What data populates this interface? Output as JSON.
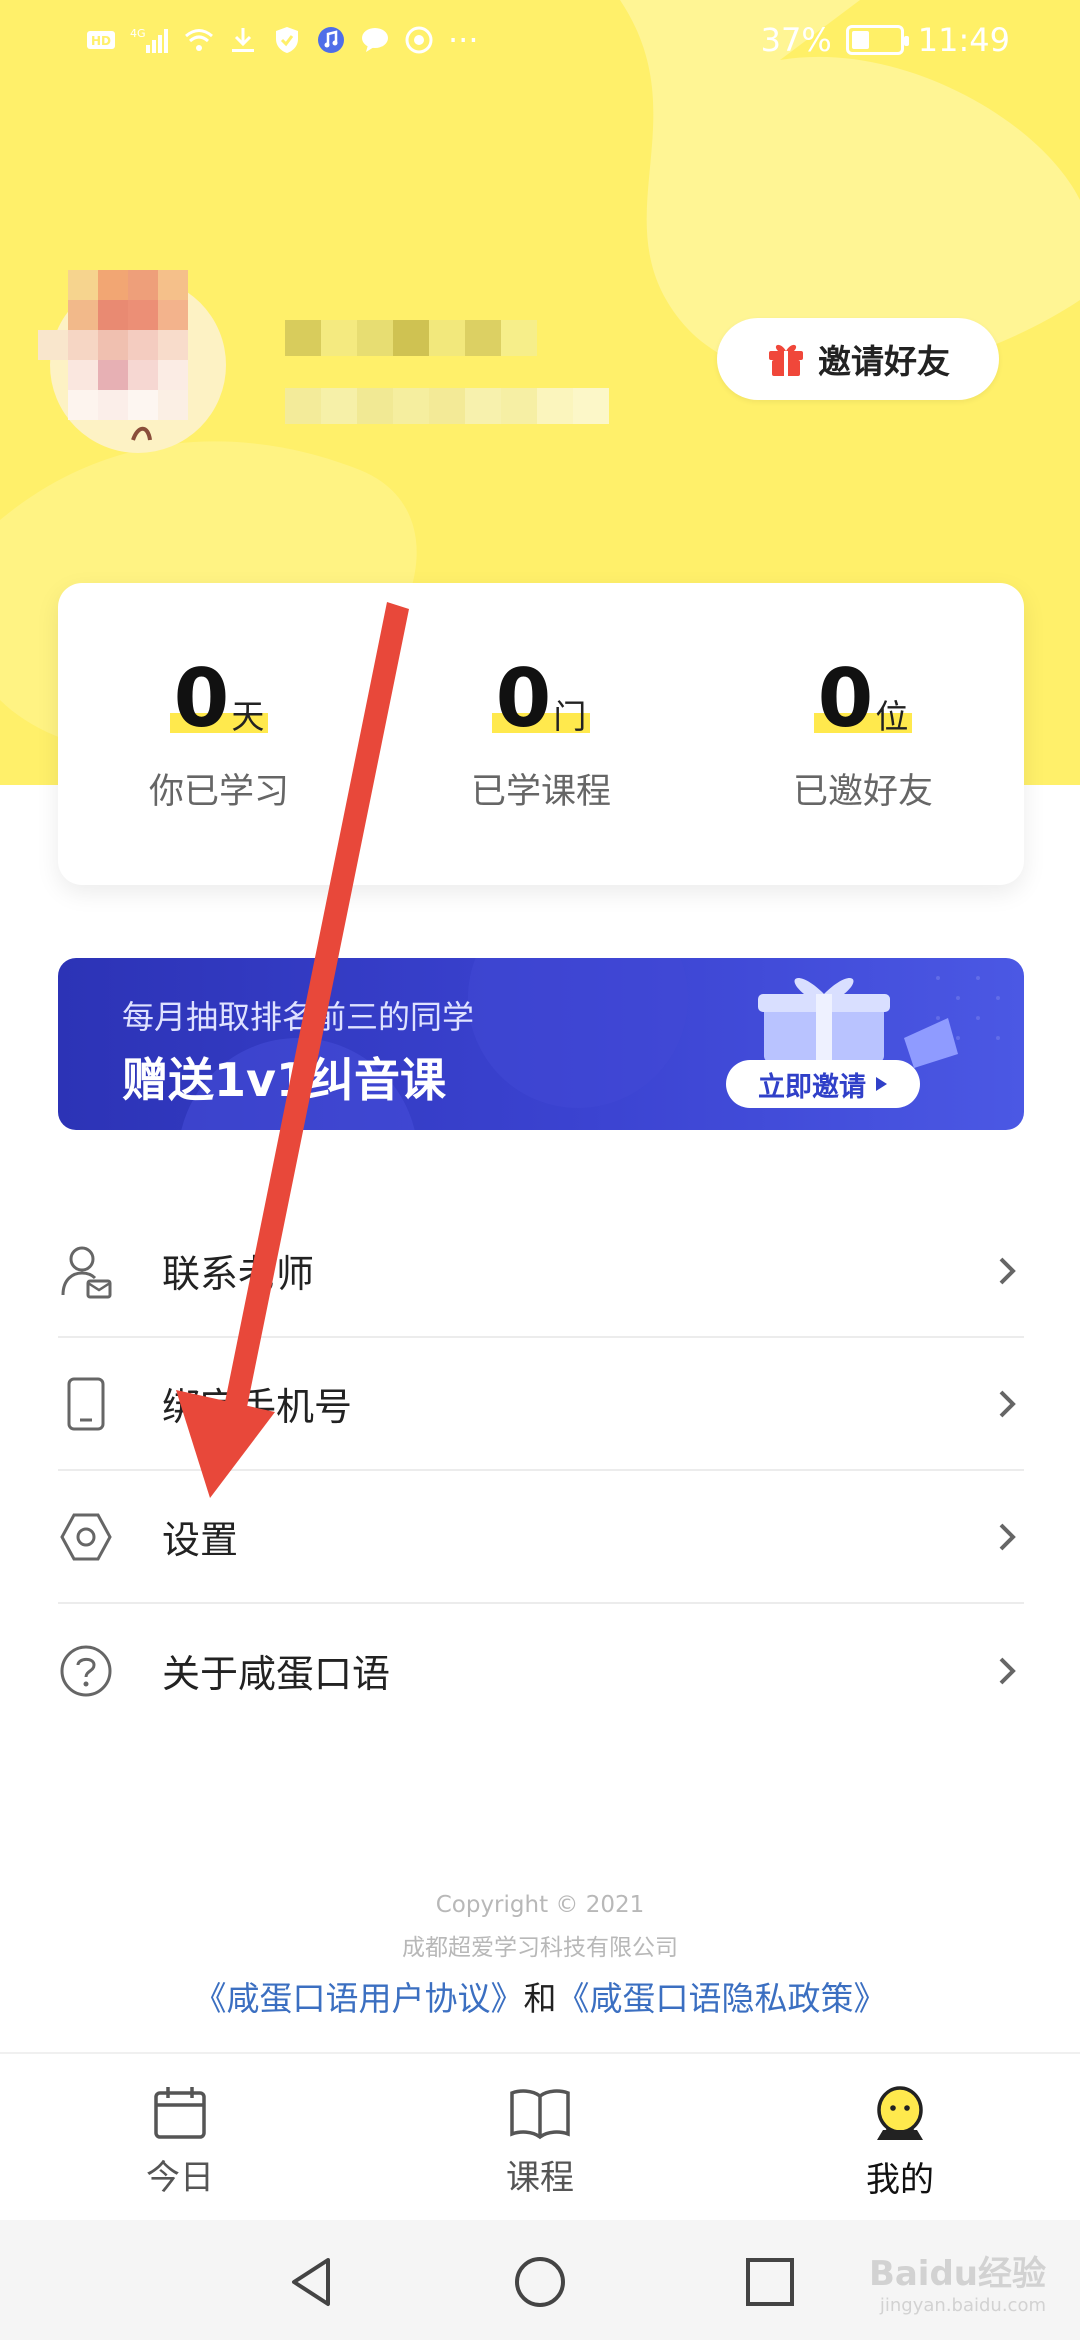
{
  "status_bar": {
    "left_icons": [
      "hd-icon",
      "signal-4g-icon",
      "wifi-icon",
      "download-icon",
      "shield-icon",
      "music-icon",
      "chat-icon",
      "settings-app-icon",
      "more-icon"
    ],
    "battery_text": "37%",
    "battery_level": 0.37,
    "time": "11:49"
  },
  "profile": {
    "invite_button": "邀请好友"
  },
  "stats": [
    {
      "value": "0",
      "unit": "天",
      "label": "你已学习"
    },
    {
      "value": "0",
      "unit": "门",
      "label": "已学课程"
    },
    {
      "value": "0",
      "unit": "位",
      "label": "已邀好友"
    }
  ],
  "banner": {
    "line1": "每月抽取排名前三的同学",
    "line2": "赠送1v1纠音课",
    "cta": "立即邀请"
  },
  "menu": [
    {
      "label": "联系老师",
      "icon": "teacher-contact-icon"
    },
    {
      "label": "绑定手机号",
      "icon": "phone-icon"
    },
    {
      "label": "设置",
      "icon": "settings-hexagon-icon"
    },
    {
      "label": "关于咸蛋口语",
      "icon": "help-question-icon"
    }
  ],
  "footer": {
    "copyright": "Copyright © 2021",
    "company": "成都超爱学习科技有限公司",
    "user_agreement": "《咸蛋口语用户协议》",
    "and": "和",
    "privacy_policy": "《咸蛋口语隐私政策》"
  },
  "tabs": [
    {
      "label": "今日",
      "icon": "calendar-icon",
      "active": false
    },
    {
      "label": "课程",
      "icon": "book-icon",
      "active": false
    },
    {
      "label": "我的",
      "icon": "profile-mascot-icon",
      "active": true
    }
  ],
  "system_nav": [
    "back-icon",
    "home-icon",
    "recents-icon"
  ],
  "watermark": {
    "brand": "Baidu经验",
    "url": "jingyan.baidu.com"
  },
  "colors": {
    "header_yellow": "#fff06a",
    "highlight_yellow": "#ffe94d",
    "banner_blue": "#2c33b6",
    "link_blue": "#3b6fc1",
    "arrow_red": "#e8483a"
  }
}
